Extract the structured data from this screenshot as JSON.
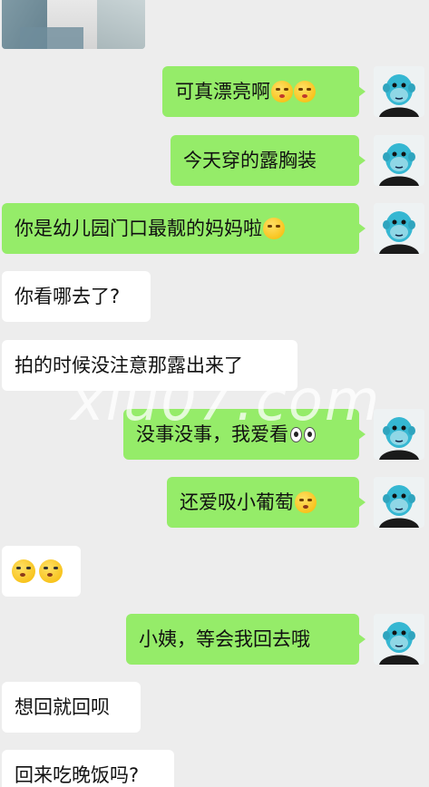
{
  "messages": [
    {
      "side": "out",
      "text": "可真漂亮啊"
    },
    {
      "side": "out",
      "text": "今天穿的露胸装"
    },
    {
      "side": "out",
      "text": "你是幼儿园门口最靓的妈妈啦"
    },
    {
      "side": "in",
      "text": "你看哪去了?"
    },
    {
      "side": "in",
      "text": "拍的时候没注意那露出来了"
    },
    {
      "side": "out",
      "text": "没事没事，我爱看"
    },
    {
      "side": "out",
      "text": "还爱吸小葡萄"
    },
    {
      "side": "in",
      "text": ""
    },
    {
      "side": "out",
      "text": "小姨，等会我回去哦"
    },
    {
      "side": "in",
      "text": "想回就回呗"
    },
    {
      "side": "in",
      "text": "回来吃晚饭吗?"
    }
  ],
  "watermark": "xiu07.com",
  "colors": {
    "outgoing_bubble": "#95ec69",
    "incoming_bubble": "#ffffff",
    "background": "#ededed"
  },
  "icons": {
    "avatar": "cartoon-ape-avatar",
    "emoji_kiss": "kissing-face-emoji",
    "emoji_eyes": "eyes-emoji",
    "emoji_laugh": "laughing-emoji",
    "emoji_think": "thinking-emoji"
  }
}
